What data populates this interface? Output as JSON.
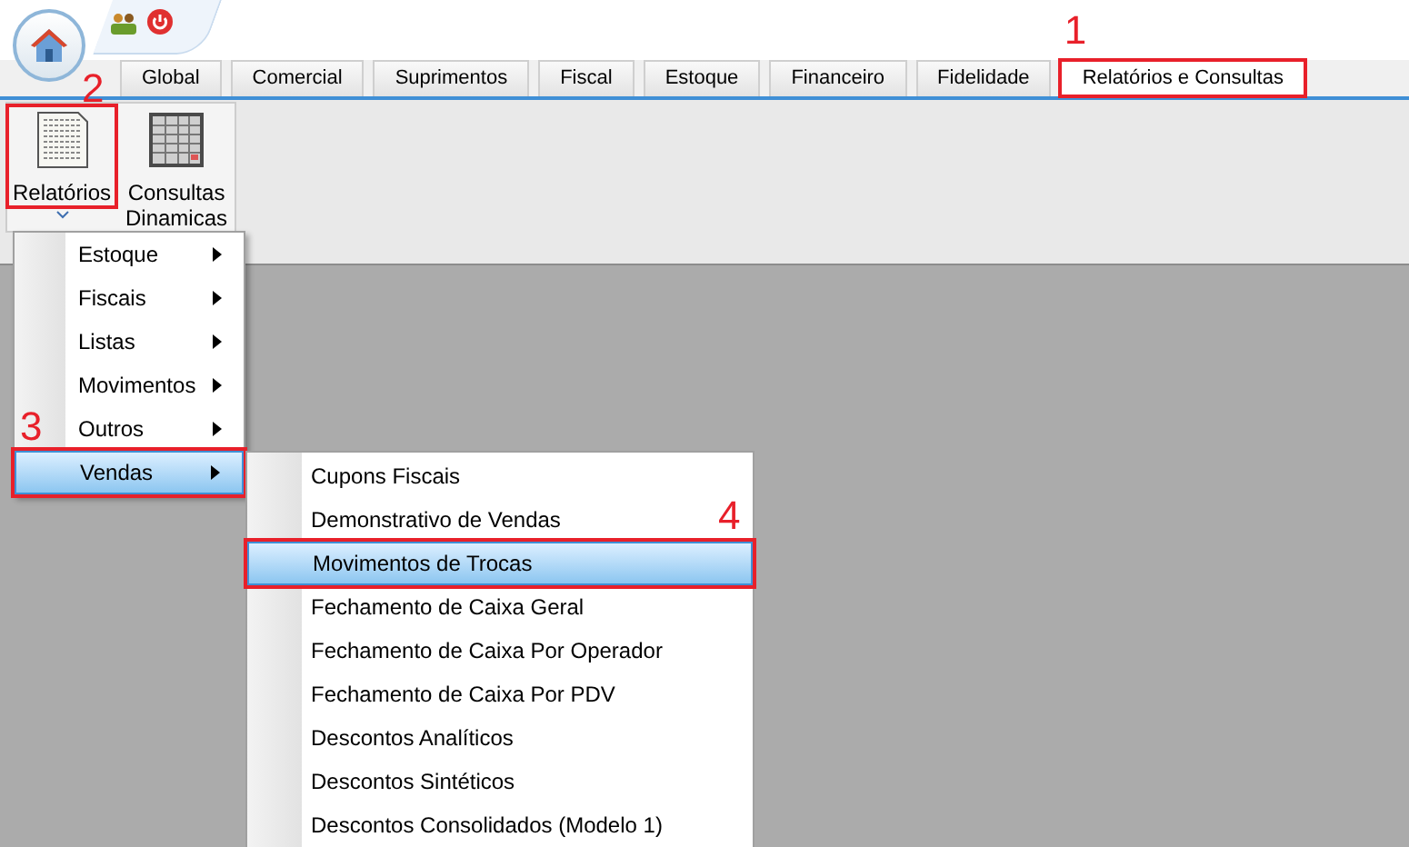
{
  "tabs": [
    {
      "label": "Global",
      "selected": false
    },
    {
      "label": "Comercial",
      "selected": false
    },
    {
      "label": "Suprimentos",
      "selected": false
    },
    {
      "label": "Fiscal",
      "selected": false
    },
    {
      "label": "Estoque",
      "selected": false
    },
    {
      "label": "Financeiro",
      "selected": false
    },
    {
      "label": "Fidelidade",
      "selected": false
    },
    {
      "label": "Relatórios e Consultas",
      "selected": true,
      "annotation": "1"
    }
  ],
  "ribbon_buttons": [
    {
      "kind": "report",
      "label": "Relatórios",
      "annotation": "2"
    },
    {
      "kind": "grid",
      "label": "Consultas Dinamicas"
    }
  ],
  "menu": {
    "items": [
      {
        "label": "Estoque",
        "selected": false
      },
      {
        "label": "Fiscais",
        "selected": false
      },
      {
        "label": "Listas",
        "selected": false
      },
      {
        "label": "Movimentos",
        "selected": false
      },
      {
        "label": "Outros",
        "selected": false
      },
      {
        "label": "Vendas",
        "selected": true,
        "annotation": "3"
      }
    ]
  },
  "submenu": {
    "items": [
      {
        "label": "Cupons Fiscais",
        "selected": false
      },
      {
        "label": "Demonstrativo de Vendas",
        "selected": false
      },
      {
        "label": "Movimentos de Trocas",
        "selected": true,
        "annotation": "4"
      },
      {
        "label": "Fechamento de Caixa Geral",
        "selected": false
      },
      {
        "label": "Fechamento de Caixa Por Operador",
        "selected": false
      },
      {
        "label": "Fechamento de Caixa Por PDV",
        "selected": false
      },
      {
        "label": "Descontos Analíticos",
        "selected": false
      },
      {
        "label": "Descontos Sintéticos",
        "selected": false
      },
      {
        "label": "Descontos Consolidados (Modelo 1)",
        "selected": false
      }
    ]
  }
}
